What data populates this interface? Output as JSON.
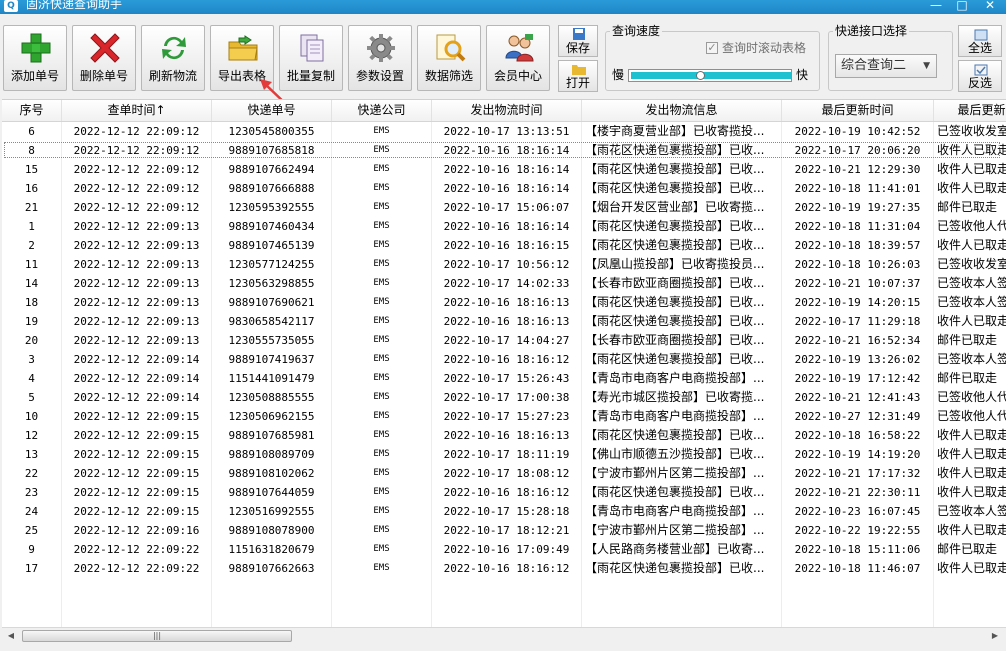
{
  "window": {
    "title": "固济快递查询助手",
    "controls": [
      "—",
      "□",
      "✕"
    ]
  },
  "toolbar": {
    "buttons": [
      {
        "name": "add",
        "label": "添加单号",
        "icon": "green-plus-icon"
      },
      {
        "name": "delete",
        "label": "删除单号",
        "icon": "red-x-icon"
      },
      {
        "name": "refresh",
        "label": "刷新物流",
        "icon": "refresh-icon"
      },
      {
        "name": "export",
        "label": "导出表格",
        "icon": "folder-export-icon"
      },
      {
        "name": "copy",
        "label": "批量复制",
        "icon": "copy-pages-icon"
      },
      {
        "name": "settings",
        "label": "参数设置",
        "icon": "gear-icon"
      },
      {
        "name": "filter",
        "label": "数据筛选",
        "icon": "magnifier-icon"
      },
      {
        "name": "member",
        "label": "会员中心",
        "icon": "users-icon"
      }
    ],
    "save_label": "保存",
    "open_label": "打开",
    "speed": {
      "legend": "查询速度",
      "scroll_label": "查询时滚动表格",
      "scroll_checked": true,
      "slow": "慢",
      "fast": "快",
      "value": 0.42
    },
    "api": {
      "legend": "快递接口选择",
      "selected": "综合查询二"
    },
    "select_all_label": "全选",
    "invert_label": "反选"
  },
  "table": {
    "columns": [
      "序号",
      "查单时间↑",
      "快递单号",
      "快递公司",
      "发出物流时间",
      "发出物流信息",
      "最后更新时间",
      "最后更新物流"
    ],
    "rows": [
      [
        "6",
        "2022-12-12 22:09:12",
        "1230545800355",
        "EMS",
        "2022-10-17 13:13:51",
        "【楼宇商夏营业部】已收寄揽投...",
        "2022-10-19 10:42:52",
        "已签收收发室"
      ],
      [
        "8",
        "2022-12-12 22:09:12",
        "9889107685818",
        "EMS",
        "2022-10-16 18:16:14",
        "【雨花区快递包裹揽投部】已收...",
        "2022-10-17 20:06:20",
        "收件人已取走"
      ],
      [
        "15",
        "2022-12-12 22:09:12",
        "9889107662494",
        "EMS",
        "2022-10-16 18:16:14",
        "【雨花区快递包裹揽投部】已收...",
        "2022-10-21 12:29:30",
        "收件人已取走"
      ],
      [
        "16",
        "2022-12-12 22:09:12",
        "9889107666888",
        "EMS",
        "2022-10-16 18:16:14",
        "【雨花区快递包裹揽投部】已收...",
        "2022-10-18 11:41:01",
        "收件人已取走"
      ],
      [
        "21",
        "2022-12-12 22:09:12",
        "1230595392555",
        "EMS",
        "2022-10-17 15:06:07",
        "【烟台开发区营业部】已收寄揽...",
        "2022-10-19 19:27:35",
        "邮件已取走"
      ],
      [
        "1",
        "2022-12-12 22:09:13",
        "9889107460434",
        "EMS",
        "2022-10-16 18:16:14",
        "【雨花区快递包裹揽投部】已收...",
        "2022-10-18 11:31:04",
        "已签收他人代"
      ],
      [
        "2",
        "2022-12-12 22:09:13",
        "9889107465139",
        "EMS",
        "2022-10-16 18:16:15",
        "【雨花区快递包裹揽投部】已收...",
        "2022-10-18 18:39:57",
        "收件人已取走"
      ],
      [
        "11",
        "2022-12-12 22:09:13",
        "1230577124255",
        "EMS",
        "2022-10-17 10:56:12",
        "【凤凰山揽投部】已收寄揽投员...",
        "2022-10-18 10:26:03",
        "已签收收发室"
      ],
      [
        "14",
        "2022-12-12 22:09:13",
        "1230563298855",
        "EMS",
        "2022-10-17 14:02:33",
        "【长春市欧亚商圈揽投部】已收...",
        "2022-10-21 10:07:37",
        "已签收本人签"
      ],
      [
        "18",
        "2022-12-12 22:09:13",
        "9889107690621",
        "EMS",
        "2022-10-16 18:16:13",
        "【雨花区快递包裹揽投部】已收...",
        "2022-10-19 14:20:15",
        "已签收本人签"
      ],
      [
        "19",
        "2022-12-12 22:09:13",
        "9830658542117",
        "EMS",
        "2022-10-16 18:16:13",
        "【雨花区快递包裹揽投部】已收...",
        "2022-10-17 11:29:18",
        "收件人已取走"
      ],
      [
        "20",
        "2022-12-12 22:09:13",
        "1230555735055",
        "EMS",
        "2022-10-17 14:04:27",
        "【长春市欧亚商圈揽投部】已收...",
        "2022-10-21 16:52:34",
        "邮件已取走"
      ],
      [
        "3",
        "2022-12-12 22:09:14",
        "9889107419637",
        "EMS",
        "2022-10-16 18:16:12",
        "【雨花区快递包裹揽投部】已收...",
        "2022-10-19 13:26:02",
        "已签收本人签"
      ],
      [
        "4",
        "2022-12-12 22:09:14",
        "1151441091479",
        "EMS",
        "2022-10-17 15:26:43",
        "【青岛市电商客户电商揽投部】...",
        "2022-10-19 17:12:42",
        "邮件已取走"
      ],
      [
        "5",
        "2022-12-12 22:09:14",
        "1230508885555",
        "EMS",
        "2022-10-17 17:00:38",
        "【寿光市城区揽投部】已收寄揽...",
        "2022-10-21 12:41:43",
        "已签收他人代"
      ],
      [
        "10",
        "2022-12-12 22:09:15",
        "1230506962155",
        "EMS",
        "2022-10-17 15:27:23",
        "【青岛市电商客户电商揽投部】...",
        "2022-10-27 12:31:49",
        "已签收他人代"
      ],
      [
        "12",
        "2022-12-12 22:09:15",
        "9889107685981",
        "EMS",
        "2022-10-16 18:16:13",
        "【雨花区快递包裹揽投部】已收...",
        "2022-10-18 16:58:22",
        "收件人已取走"
      ],
      [
        "13",
        "2022-12-12 22:09:15",
        "9889108089709",
        "EMS",
        "2022-10-17 18:11:19",
        "【佛山市顺德五沙揽投部】已收...",
        "2022-10-19 14:19:20",
        "收件人已取走"
      ],
      [
        "22",
        "2022-12-12 22:09:15",
        "9889108102062",
        "EMS",
        "2022-10-17 18:08:12",
        "【宁波市鄞州片区第二揽投部】...",
        "2022-10-21 17:17:32",
        "收件人已取走"
      ],
      [
        "23",
        "2022-12-12 22:09:15",
        "9889107644059",
        "EMS",
        "2022-10-16 18:16:12",
        "【雨花区快递包裹揽投部】已收...",
        "2022-10-21 22:30:11",
        "收件人已取走"
      ],
      [
        "24",
        "2022-12-12 22:09:15",
        "1230516992555",
        "EMS",
        "2022-10-17 15:28:18",
        "【青岛市电商客户电商揽投部】...",
        "2022-10-23 16:07:45",
        "已签收本人签"
      ],
      [
        "25",
        "2022-12-12 22:09:16",
        "9889108078900",
        "EMS",
        "2022-10-17 18:12:21",
        "【宁波市鄞州片区第二揽投部】...",
        "2022-10-22 19:22:55",
        "收件人已取走"
      ],
      [
        "9",
        "2022-12-12 22:09:22",
        "1151631820679",
        "EMS",
        "2022-10-16 17:09:49",
        "【人民路商务楼营业部】已收寄...",
        "2022-10-18 15:11:06",
        "邮件已取走"
      ],
      [
        "17",
        "2022-12-12 22:09:22",
        "9889107662663",
        "EMS",
        "2022-10-16 18:16:12",
        "【雨花区快递包裹揽投部】已收...",
        "2022-10-18 11:46:07",
        "收件人已取走"
      ]
    ]
  },
  "scrollbar": {
    "left_arrow": "◀",
    "right_arrow": "▶",
    "grip": "|||"
  }
}
